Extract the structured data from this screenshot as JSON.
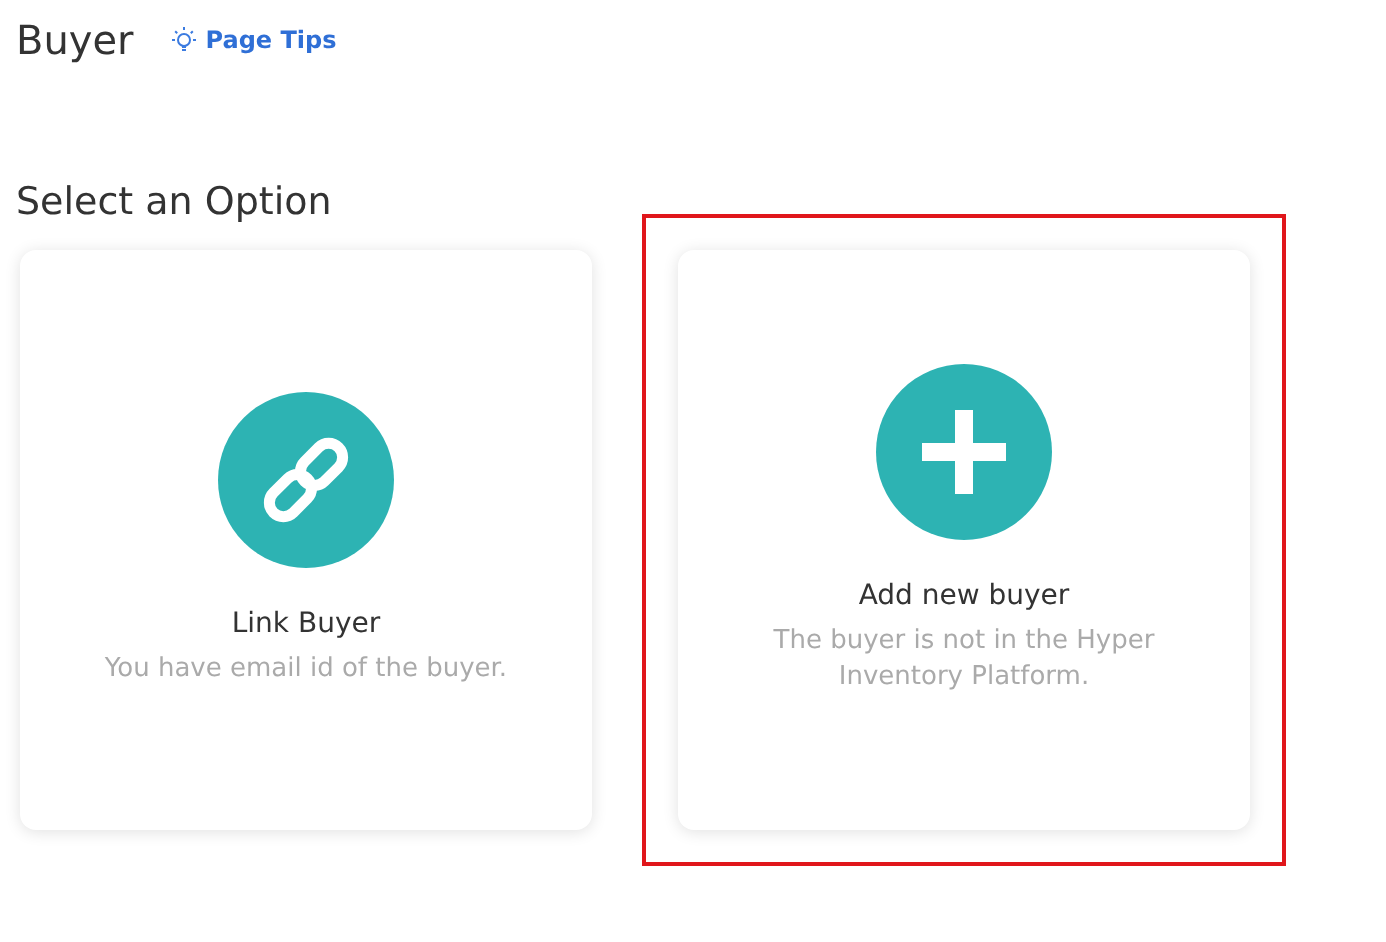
{
  "header": {
    "title": "Buyer",
    "tips_link": "Page Tips"
  },
  "section_title": "Select an Option",
  "options": [
    {
      "kind": "link",
      "title": "Link Buyer",
      "description": "You have email id of the buyer.",
      "highlighted": false
    },
    {
      "kind": "add",
      "title": "Add new buyer",
      "description": "The buyer is not in the Hyper Inventory Platform.",
      "highlighted": true
    }
  ]
}
